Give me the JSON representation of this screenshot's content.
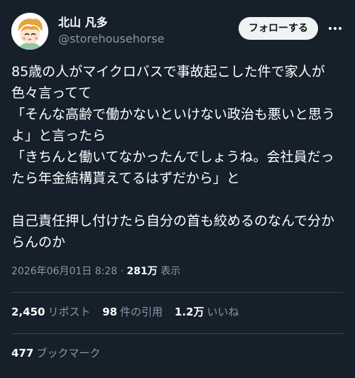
{
  "user": {
    "display_name": "北山 凡多",
    "handle": "@storehousehorse",
    "avatar": "avatar-illustration"
  },
  "follow_button": {
    "label": "フォローする"
  },
  "more_icon": "more-horizontal-icon",
  "tweet": {
    "text": "85歳の人がマイクロバスで事故起こした件で家人が色々言ってて\n「そんな高齢で働かないといけない政治も悪いと思うよ」と言ったら\n「きちんと働いてなかったんでしょうね。会社員だったら年金結構貰えてるはずだから」と\n\n自己責任押し付けたら自分の首も絞めるのなんで分からんのか"
  },
  "meta": {
    "date": "2026年06月01日 8:28",
    "separator": "·",
    "views": "281万",
    "views_label": "表示"
  },
  "stats": {
    "reposts": {
      "count": "2,450",
      "label": "リポスト"
    },
    "quotes": {
      "count": "98",
      "label": "件の引用"
    },
    "likes": {
      "count": "1.2万",
      "label": "いいね"
    }
  },
  "bookmarks": {
    "count": "477",
    "label": "ブックマーク"
  },
  "colors": {
    "background": "#15202b",
    "text_primary": "#ffffff",
    "text_secondary": "#8b98a5",
    "divider": "#38444d",
    "button_bg": "#eff3f4",
    "button_text": "#0f1419"
  }
}
